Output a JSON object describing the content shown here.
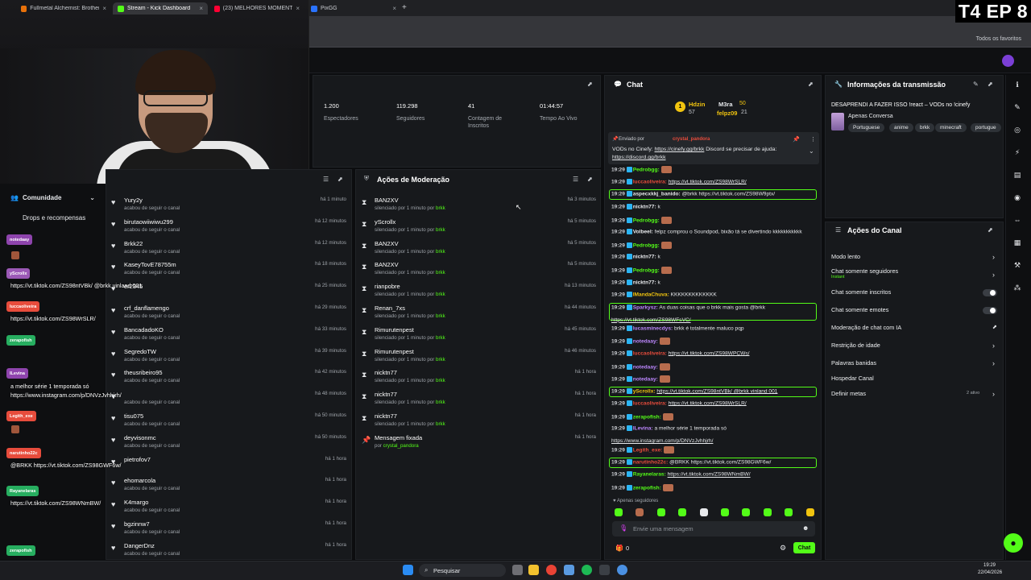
{
  "browser": {
    "tabs": [
      {
        "label": "Fullmetal Alchemist: Brotherho",
        "color": "#e8710a"
      },
      {
        "label": "Stream - Kick Dashboard",
        "color": "#53fc18"
      },
      {
        "label": "(23) MELHORES MOMENTOS F",
        "color": "#ff0033"
      },
      {
        "label": "PixGG",
        "color": "#2a73ff"
      }
    ],
    "bookmarks_all": "Todos os favoritos"
  },
  "overlay_badge": "T4 EP 8",
  "sidebar": {
    "comunidade": "Comunidade",
    "drops": "Drops e recompensas",
    "chips": [
      {
        "label": "notedaay",
        "color": "#8e44ad"
      },
      {
        "label": "yScrollx",
        "color": "#9b59b6"
      },
      {
        "label": "luccaoliveira",
        "color": "#e74c3c"
      },
      {
        "label": "zerapofish",
        "color": "#27ae60"
      },
      {
        "label": "ILevina",
        "color": "#8e44ad"
      },
      {
        "label": "Legith_exe",
        "color": "#e74c3c"
      },
      {
        "label": "narutinho22c",
        "color": "#e74c3c"
      },
      {
        "label": "Rayanelaras",
        "color": "#27ae60"
      },
      {
        "label": "zerapofish",
        "color": "#27ae60"
      }
    ],
    "floating": [
      "https://vt.tiktok.com/ZS98ntVBk/ @brkk vinland 001",
      "https://vt.tiktok.com/ZS98WrSLR/",
      "a melhor série 1 temporada só",
      "https://www.instagram.com/p/DNVzJvhhjrh/",
      "@BRKK https://vt.tiktok.com/ZS98GWF6w/",
      "https://vt.tiktok.com/ZS98WNmBW/"
    ]
  },
  "stats": [
    {
      "value": "1.200",
      "label": "Espectadores"
    },
    {
      "value": "119.298",
      "label": "Seguidores"
    },
    {
      "value": "41",
      "label": "Contagem de Inscritos"
    },
    {
      "value": "01:44:57",
      "label": "Tempo Ao Vivo"
    }
  ],
  "followers": {
    "items": [
      {
        "name": "Yury2y",
        "sub": "acabou de seguir o canal",
        "time": "há 1 minuto"
      },
      {
        "name": "birutaowiiwiwu299",
        "sub": "acabou de seguir o canal",
        "time": "há 12 minutos"
      },
      {
        "name": "Brkk22",
        "sub": "acabou de seguir o canal",
        "time": "há 12 minutos"
      },
      {
        "name": "KaseyTovE78755m",
        "sub": "acabou de seguir o canal",
        "time": "há 18 minutos"
      },
      {
        "name": "er2345",
        "sub": "",
        "time": "há 25 minutos"
      },
      {
        "name": "crf_danflamengo",
        "sub": "acabou de seguir o canal",
        "time": "há 29 minutos"
      },
      {
        "name": "BancadadoKO",
        "sub": "acabou de seguir o canal",
        "time": "há 33 minutos"
      },
      {
        "name": "SegredoTW",
        "sub": "acabou de seguir o canal",
        "time": "há 39 minutos"
      },
      {
        "name": "theusribeiro95",
        "sub": "acabou de seguir o canal",
        "time": "há 42 minutos"
      },
      {
        "name": "",
        "sub": "acabou de seguir o canal",
        "time": "há 48 minutos"
      },
      {
        "name": "tisu075",
        "sub": "acabou de seguir o canal",
        "time": "há 50 minutos"
      },
      {
        "name": "deyvisonmc",
        "sub": "acabou de seguir o canal",
        "time": "há 50 minutos"
      },
      {
        "name": "pietrofov7",
        "sub": "",
        "time": "há 1 hora"
      },
      {
        "name": "ehomarcola",
        "sub": "acabou de seguir o canal",
        "time": "há 1 hora"
      },
      {
        "name": "K4margo",
        "sub": "acabou de seguir o canal",
        "time": "há 1 hora"
      },
      {
        "name": "bgzinnw7",
        "sub": "acabou de seguir o canal",
        "time": "há 1 hora"
      },
      {
        "name": "DangerDnz",
        "sub": "acabou de seguir o canal",
        "time": "há 1 hora"
      }
    ]
  },
  "moderation": {
    "title": "Ações de Moderação",
    "items": [
      {
        "name": "BAN2XV",
        "sub": "silenciado por 1 minuto por ",
        "by": "brkk",
        "time": "há 3 minutos"
      },
      {
        "name": "yScrollx",
        "sub": "silenciado por 1 minuto por ",
        "by": "brkk",
        "time": "há 5 minutos"
      },
      {
        "name": "BAN2XV",
        "sub": "silenciado por 1 minuto por ",
        "by": "brkk",
        "time": "há 5 minutos"
      },
      {
        "name": "BAN2XV",
        "sub": "silenciado por 1 minuto por ",
        "by": "brkk",
        "time": "há 5 minutos"
      },
      {
        "name": "rianpobre",
        "sub": "silenciado por 1 minuto por ",
        "by": "brkk",
        "time": "há 13 minutos"
      },
      {
        "name": "Renan_7xs",
        "sub": "silenciado por 1 minuto por ",
        "by": "brkk",
        "time": "há 44 minutos"
      },
      {
        "name": "Rimurutenpest",
        "sub": "silenciado por 1 minuto por ",
        "by": "brkk",
        "time": "há 45 minutos"
      },
      {
        "name": "Rimurutenpest",
        "sub": "silenciado por 1 minuto por ",
        "by": "brkk",
        "time": "há 46 minutos"
      },
      {
        "name": "nicktn77",
        "sub": "silenciado por 1 minuto por ",
        "by": "brkk",
        "time": "há 1 hora"
      },
      {
        "name": "nicktn77",
        "sub": "silenciado por 1 minuto por ",
        "by": "brkk",
        "time": "há 1 hora"
      },
      {
        "name": "nicktn77",
        "sub": "silenciado por 1 minuto por ",
        "by": "brkk",
        "time": "há 1 hora"
      },
      {
        "name": "Mensagem fixada",
        "sub": "por ",
        "by": "crystal_pandora",
        "time": "há 1 hora"
      }
    ]
  },
  "chat": {
    "title": "Chat",
    "top_gifters": [
      {
        "name": "Hdzin",
        "value": "57"
      },
      {
        "name": "M3ra",
        "value": "50"
      },
      {
        "name": "felpz09",
        "value": "21"
      }
    ],
    "pinned": {
      "by_label": "Enviado por",
      "by": "crystal_pandora",
      "text": "VODs no Cinefy: ",
      "link1": "https://cinefy.gg/brkk",
      "text2": " Discord se precisar de ajuda:",
      "link2": "https://discord.gg/brkk"
    },
    "messages": [
      {
        "time": "19:29",
        "user": "Pedrobgg:",
        "color": "#53fc18",
        "text": "",
        "emote": true
      },
      {
        "time": "19:29",
        "user": "luccaoliveira:",
        "color": "#e74c3c",
        "text": "https://vt.tiktok.com/ZS98WrSLR/"
      },
      {
        "time": "19:29",
        "user": "aspecxkkj_banido:",
        "color": "#e7e9ec",
        "text": "@brkk https://vt.tiktok.com/ZS98W9ptx/"
      },
      {
        "time": "19:29",
        "user": "nicktn77:",
        "color": "#e7e9ec",
        "text": "k"
      },
      {
        "time": "19:29",
        "user": "Pedrobgg:",
        "color": "#53fc18",
        "text": "",
        "emote": true
      },
      {
        "time": "19:29",
        "user": "Volbeel:",
        "color": "#e7e9ec",
        "text": "felpz comprou o Soundpod, bixão tá se divertindo kkkkkkkkkkk"
      },
      {
        "time": "19:29",
        "user": "Pedrobgg:",
        "color": "#53fc18",
        "text": "",
        "emote": true
      },
      {
        "time": "19:29",
        "user": "nicktn77:",
        "color": "#e7e9ec",
        "text": "k"
      },
      {
        "time": "19:29",
        "user": "Pedrobgg:",
        "color": "#53fc18",
        "text": "",
        "emote": true
      },
      {
        "time": "19:29",
        "user": "nicktn77:",
        "color": "#e7e9ec",
        "text": "k"
      },
      {
        "time": "19:29",
        "user": "IMandaChuva:",
        "color": "#f1c40f",
        "text": "KKKKKKKKKKKKK"
      },
      {
        "time": "19:29",
        "user": "Sparkysz:",
        "color": "#bb86fc",
        "text": "As duas coisas que o brkk mais gosta @brkk"
      },
      {
        "time": "",
        "user": "",
        "color": "#e7e9ec",
        "text": "https://vt.tiktok.com/ZS98WFsVC/"
      },
      {
        "time": "19:29",
        "user": "lucasminecdys:",
        "color": "#bb86fc",
        "text": "brkk é totalmente maluco pqp"
      },
      {
        "time": "19:29",
        "user": "notedaay:",
        "color": "#bb86fc",
        "text": "",
        "emote": true
      },
      {
        "time": "19:29",
        "user": "luccaoliveira:",
        "color": "#e74c3c",
        "text": "https://vt.tiktok.com/ZS98WPCWs/"
      },
      {
        "time": "19:29",
        "user": "notedaay:",
        "color": "#bb86fc",
        "text": "",
        "emote": true
      },
      {
        "time": "19:29",
        "user": "notedaay:",
        "color": "#bb86fc",
        "text": "",
        "emote": true
      },
      {
        "time": "19:29",
        "user": "yScrollx:",
        "color": "#f1c40f",
        "text": "https://vt.tiktok.com/ZS98ntVBk/ @brkk vinland 001"
      },
      {
        "time": "19:29",
        "user": "luccaoliveira:",
        "color": "#e74c3c",
        "text": "https://vt.tiktok.com/ZS98WrSLR/"
      },
      {
        "time": "19:29",
        "user": "zerapofish:",
        "color": "#53fc18",
        "text": "",
        "emote": true
      },
      {
        "time": "19:29",
        "user": "ILevina:",
        "color": "#bb86fc",
        "text": "a melhor série 1 temporada só"
      },
      {
        "time": "",
        "user": "",
        "color": "#e7e9ec",
        "text": "https://www.instagram.com/p/DNVzJvhhjrh/"
      },
      {
        "time": "19:29",
        "user": "Legith_exe:",
        "color": "#e74c3c",
        "text": "",
        "emote": true
      },
      {
        "time": "19:29",
        "user": "narutinho22c:",
        "color": "#e74c3c",
        "text": "@BRKK https://vt.tiktok.com/ZS98GWF6w/"
      },
      {
        "time": "19:29",
        "user": "Rayanelaras:",
        "color": "#53fc18",
        "text": "https://vt.tiktok.com/ZS98WNmBW/"
      },
      {
        "time": "19:29",
        "user": "zerapofish:",
        "color": "#53fc18",
        "text": "",
        "emote": true
      }
    ],
    "followers_only": "Apenas seguidores",
    "input_placeholder": "Envie uma mensagem",
    "count": "0",
    "send_label": "Chat"
  },
  "stream_info": {
    "title": "Informações da transmissão",
    "stream_title": "DESAPRENDI A FAZER ISSO !react – VODs no !cinefy",
    "category": "Apenas Conversa",
    "tags": [
      "Portuguese",
      "anime",
      "brkk",
      "minecraft",
      "portugue"
    ]
  },
  "channel_actions": {
    "title": "Ações do Canal",
    "items": [
      {
        "label": "Modo lento",
        "sub": "",
        "control": "arrow"
      },
      {
        "label": "Chat somente seguidores",
        "sub": "Instant",
        "control": "arrow"
      },
      {
        "label": "Chat somente inscritos",
        "sub": "",
        "control": "toggle"
      },
      {
        "label": "Chat somente emotes",
        "sub": "",
        "control": "toggle"
      },
      {
        "label": "Moderação de chat com IA",
        "sub": "",
        "control": "external"
      },
      {
        "label": "Restrição de idade",
        "sub": "",
        "control": "arrow"
      },
      {
        "label": "Palavras banidas",
        "sub": "",
        "control": "arrow"
      },
      {
        "label": "Hospedar Canal",
        "sub": "",
        "control": "none"
      },
      {
        "label": "Definir metas",
        "sub": "",
        "control": "arrow",
        "extra": "2 ativo"
      }
    ]
  },
  "taskbar": {
    "search": "Pesquisar",
    "time": "19:29",
    "date": "22/04/2026"
  }
}
